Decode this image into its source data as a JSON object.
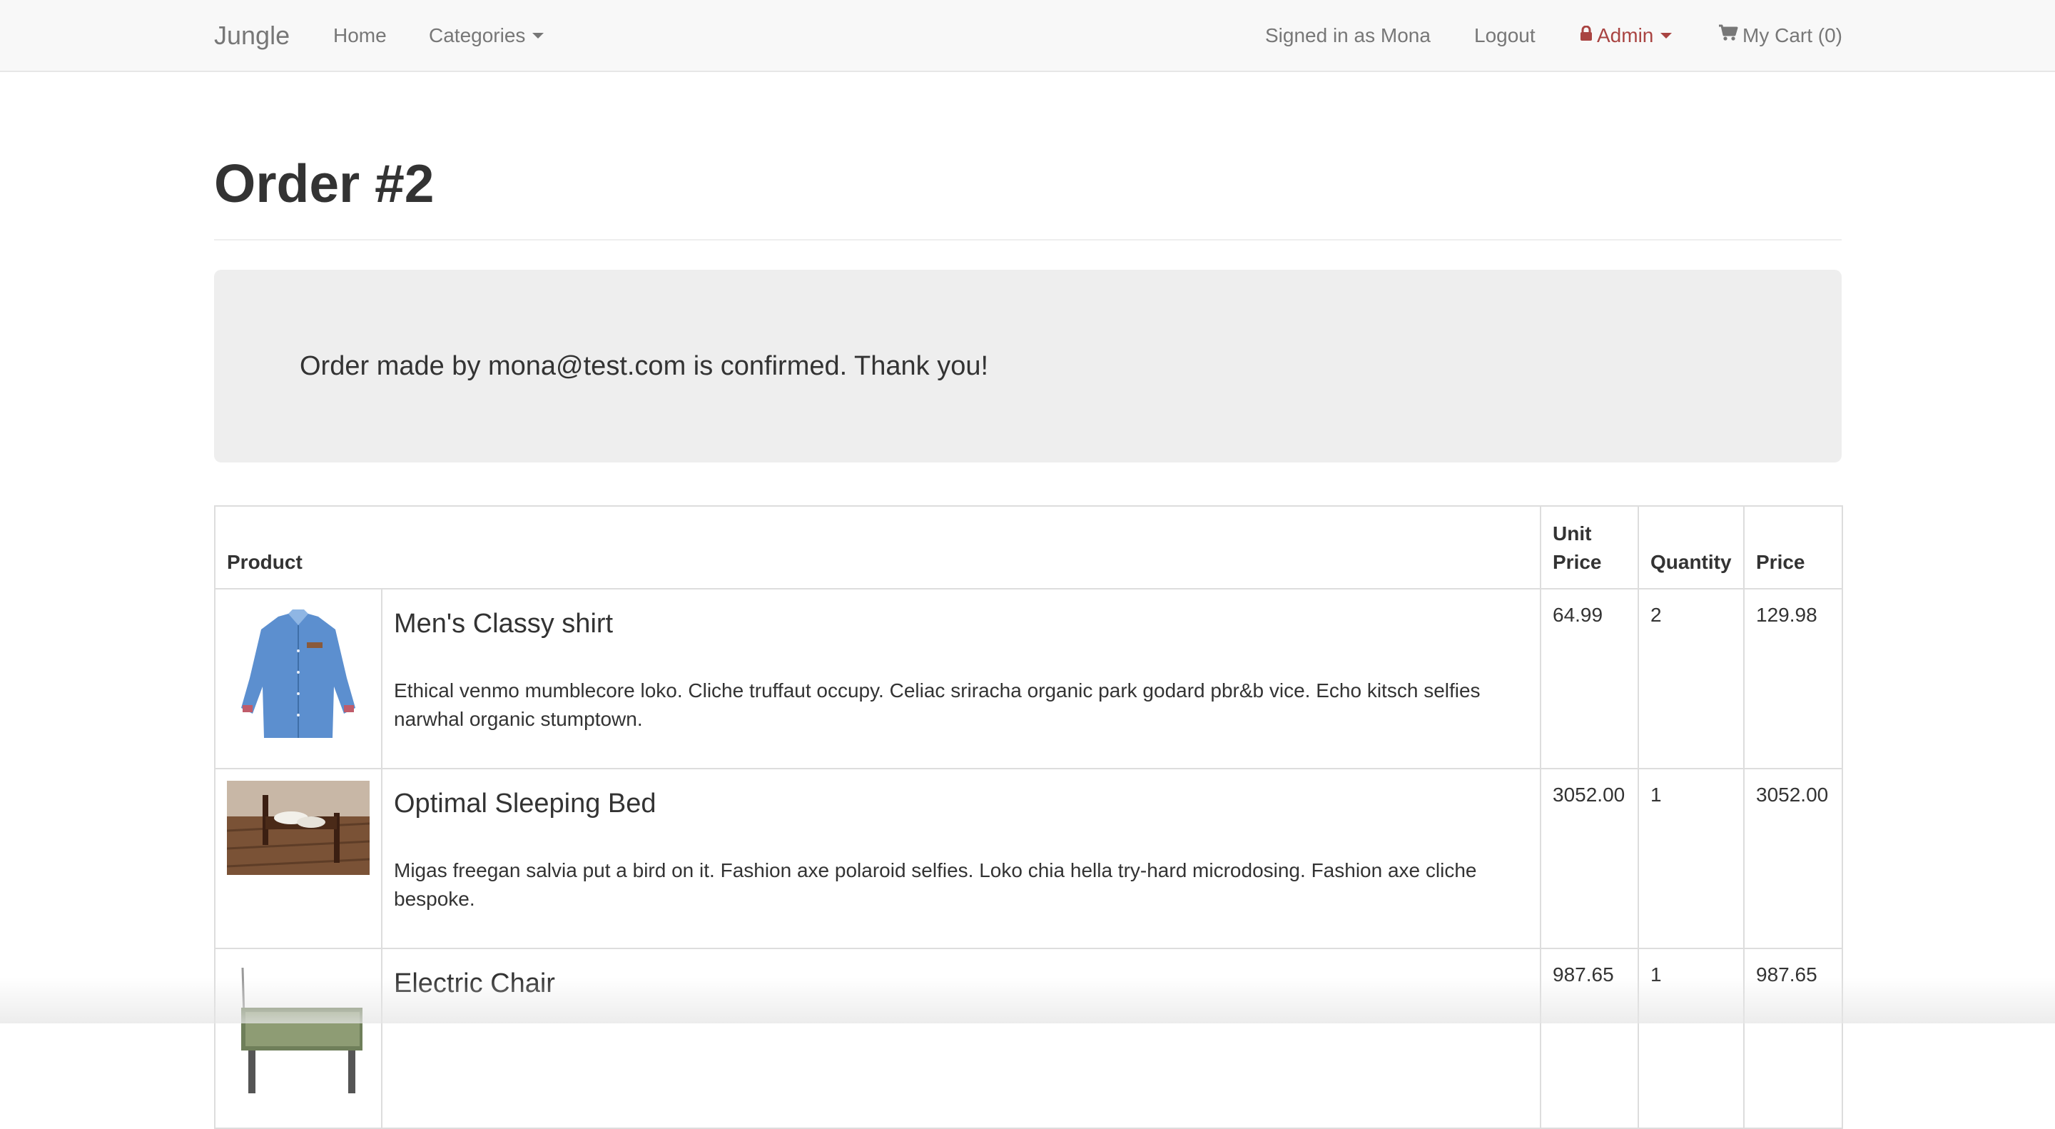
{
  "navbar": {
    "brand": "Jungle",
    "home": "Home",
    "categories": "Categories",
    "signed_in": "Signed in as Mona",
    "logout": "Logout",
    "admin": "Admin",
    "cart": "My Cart (0)",
    "colors": {
      "background": "#f8f8f8",
      "link": "#777777",
      "admin": "#a94442"
    }
  },
  "page": {
    "title": "Order #2"
  },
  "confirmation": {
    "message": "Order made by mona@test.com is confirmed. Thank you!"
  },
  "table": {
    "headers": {
      "product": "Product",
      "unit_price": "Unit Price",
      "quantity": "Quantity",
      "price": "Price"
    },
    "rows": [
      {
        "image": "blue-denim-shirt-photo",
        "name": "Men's Classy shirt",
        "description": "Ethical venmo mumblecore loko. Cliche truffaut occupy. Celiac sriracha organic park godard pbr&b vice. Echo kitsch selfies narwhal organic stumptown.",
        "unit_price": "64.99",
        "quantity": "2",
        "price": "129.98"
      },
      {
        "image": "wooden-bed-photo",
        "name": "Optimal Sleeping Bed",
        "description": "Migas freegan salvia put a bird on it. Fashion axe polaroid selfies. Loko chia hella try-hard microdosing. Fashion axe cliche bespoke.",
        "unit_price": "3052.00",
        "quantity": "1",
        "price": "3052.00"
      },
      {
        "image": "electric-chair-photo",
        "name": "Electric Chair",
        "description": "",
        "unit_price": "987.65",
        "quantity": "1",
        "price": "987.65"
      }
    ]
  }
}
